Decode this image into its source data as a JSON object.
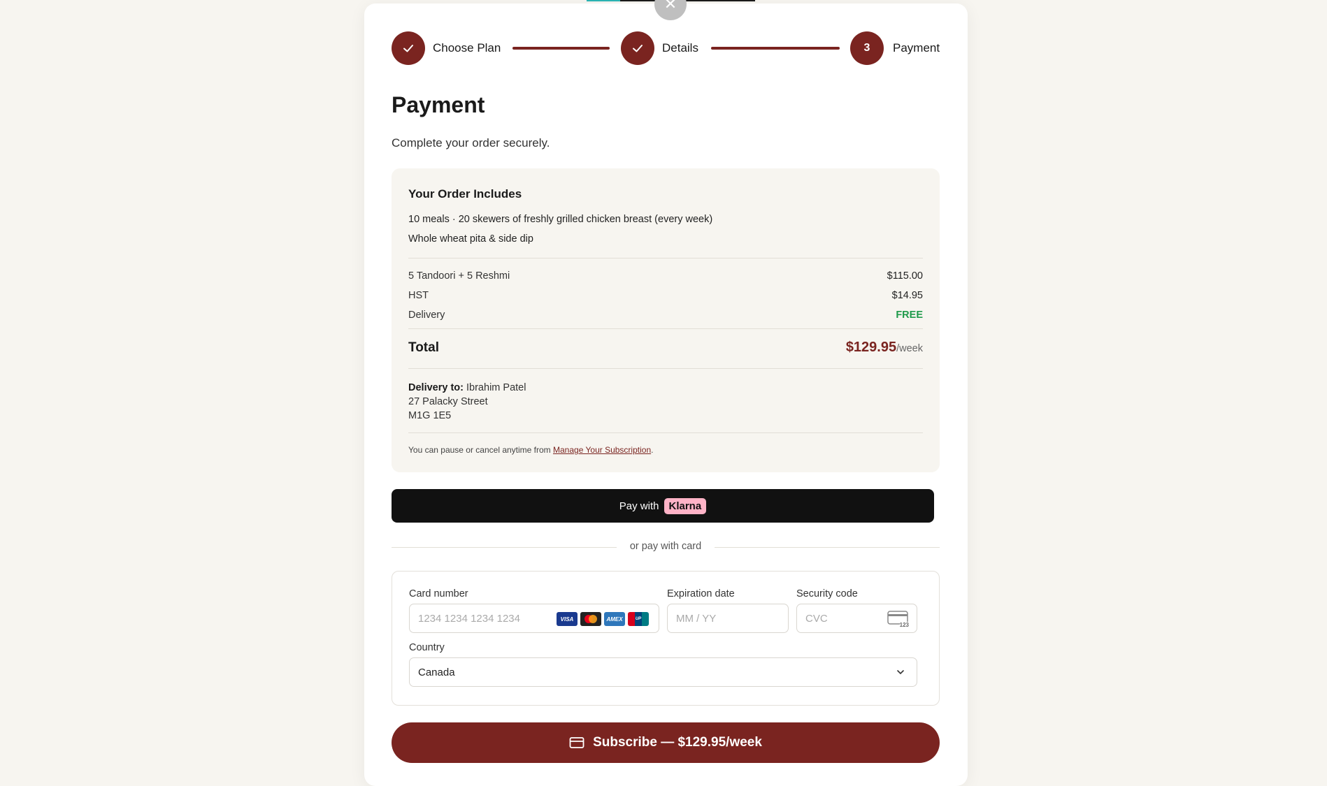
{
  "stepper": {
    "steps": [
      {
        "label": "Choose Plan",
        "state": "completed",
        "icon": "check-icon"
      },
      {
        "label": "Details",
        "state": "completed",
        "icon": "check-icon"
      },
      {
        "label": "Payment",
        "state": "current",
        "number": "3"
      }
    ]
  },
  "page": {
    "title": "Payment",
    "subtitle": "Complete your order securely."
  },
  "order": {
    "heading": "Your Order Includes",
    "description": "10 meals · 20 skewers of freshly grilled chicken breast (every week)",
    "sides": "Whole wheat pita & side dip",
    "lines": [
      {
        "label": "5 Tandoori + 5 Reshmi",
        "value": "$115.00"
      },
      {
        "label": "HST",
        "value": "$14.95"
      },
      {
        "label": "Delivery",
        "value": "FREE"
      }
    ],
    "total_label": "Total",
    "total_amount": "$129.95",
    "total_period": "/week",
    "delivery_label": "Delivery to:",
    "delivery_name": "Ibrahim Patel",
    "delivery_street": "27 Palacky Street",
    "delivery_postal": "M1G 1E5",
    "note_text": "You can pause or cancel anytime from ",
    "note_link": "Manage Your Subscription",
    "note_end": "."
  },
  "klarna": {
    "prefix": "Pay with",
    "brand": "Klarna"
  },
  "divider_text": "or pay with card",
  "card_form": {
    "card_number_label": "Card number",
    "card_number_placeholder": "1234 1234 1234 1234",
    "card_brands": [
      "VISA",
      "Mastercard",
      "AMEX",
      "UnionPay"
    ],
    "expiry_label": "Expiration date",
    "expiry_placeholder": "MM / YY",
    "cvc_label": "Security code",
    "cvc_placeholder": "CVC",
    "cvc_hint": "123",
    "country_label": "Country",
    "country_value": "Canada"
  },
  "subscribe": {
    "label": "Subscribe — $129.95/week"
  },
  "colors": {
    "accent": "#7a2420",
    "free": "#1e9a4a",
    "klarna_pink": "#ffb3c7",
    "page_bg": "#f7f5f0"
  }
}
